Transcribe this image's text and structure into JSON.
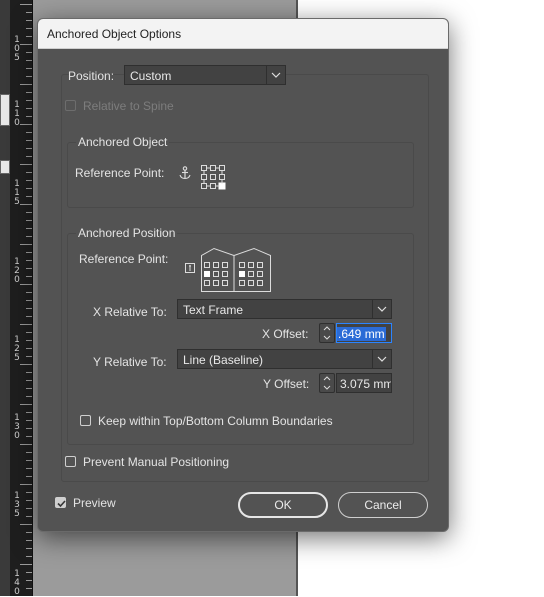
{
  "ruler": {
    "labels": [
      "105",
      "110",
      "115",
      "120",
      "125",
      "130",
      "135",
      "140"
    ]
  },
  "dialog": {
    "title": "Anchored Object Options",
    "position_label": "Position:",
    "position_value": "Custom",
    "relative_to_spine_label": "Relative to Spine",
    "relative_to_spine_checked": false,
    "relative_to_spine_enabled": false,
    "anchored_object": {
      "title": "Anchored Object",
      "reference_point_label": "Reference Point:"
    },
    "anchored_position": {
      "title": "Anchored Position",
      "reference_point_label": "Reference Point:",
      "x_relative_label": "X Relative To:",
      "x_relative_value": "Text Frame",
      "x_offset_label": "X Offset:",
      "x_offset_value": ".649 mm",
      "y_relative_label": "Y Relative To:",
      "y_relative_value": "Line (Baseline)",
      "y_offset_label": "Y Offset:",
      "y_offset_value": "3.075 mm",
      "keep_within_label": "Keep within Top/Bottom Column Boundaries",
      "keep_within_checked": false
    },
    "prevent_manual_label": "Prevent Manual Positioning",
    "prevent_manual_checked": false,
    "preview_label": "Preview",
    "preview_checked": true,
    "ok_label": "OK",
    "cancel_label": "Cancel"
  },
  "icons": {
    "anchor": "anchor-icon",
    "reference_grid": "reference-point-grid-icon",
    "spread_reference": "spread-reference-point-icon",
    "chevron": "chevron-down-icon",
    "spinner": "stepper-arrows-icon"
  },
  "colors": {
    "dialog_bg": "#535353",
    "field_bg": "#424242",
    "selection": "#2b6bd6",
    "pasteboard": "#9b9b9b"
  }
}
